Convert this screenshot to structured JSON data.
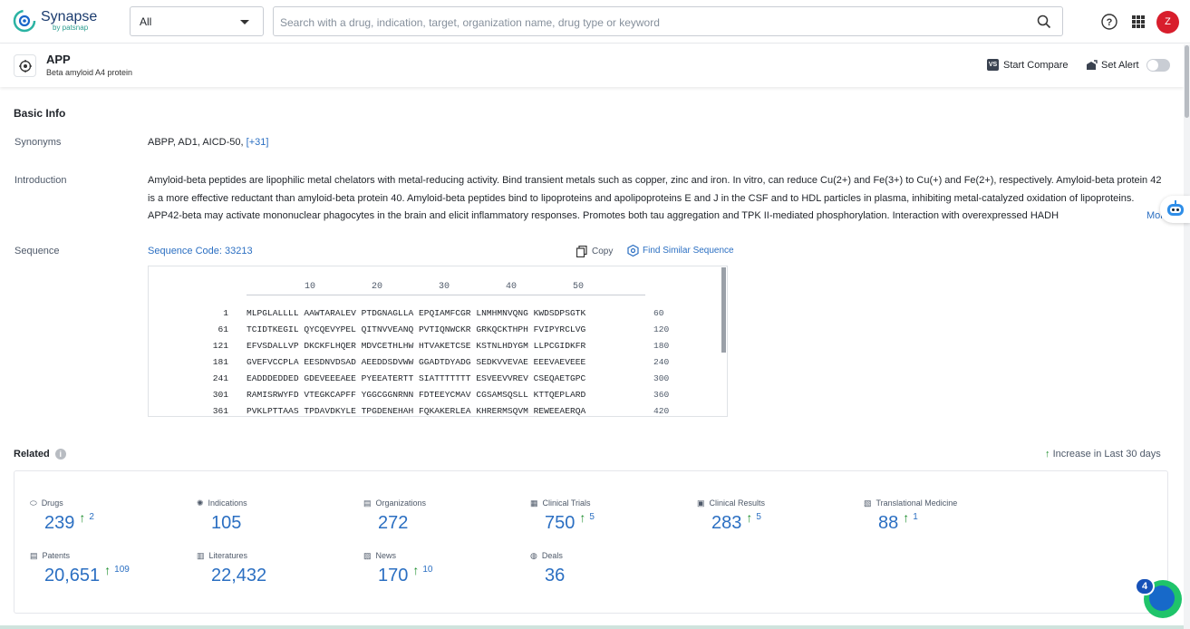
{
  "app": {
    "name": "Synapse",
    "by": "by patsnap"
  },
  "search": {
    "category": "All",
    "placeholder": "Search with a drug, indication, target, organization name, drug type or keyword"
  },
  "user": {
    "avatar_letter": "Z"
  },
  "target": {
    "title": "APP",
    "subtitle": "Beta amyloid A4 protein",
    "compare_label": "Start Compare",
    "compare_badge": "VS",
    "alert_label": "Set Alert"
  },
  "basic_info": {
    "title": "Basic Info",
    "synonyms_label": "Synonyms",
    "synonyms": "ABPP,  AD1,  AICD-50,",
    "synonyms_more": "[+31]",
    "introduction_label": "Introduction",
    "introduction": "Amyloid-beta peptides are lipophilic metal chelators with metal-reducing activity. Bind transient metals such as copper, zinc and iron. In vitro, can reduce Cu(2+) and Fe(3+) to Cu(+) and Fe(2+), respectively. Amyloid-beta protein 42 is a more effective reductant than amyloid-beta protein 40. Amyloid-beta peptides bind to lipoproteins and apolipoproteins E and J in the CSF and to HDL particles in plasma, inhibiting metal-catalyzed oxidation of lipoproteins. APP42-beta may activate mononuclear phagocytes in the brain and elicit inflammatory responses. Promotes both tau aggregation and TPK II-mediated phosphorylation. Interaction with overexpressed HADH",
    "introduction_more": "More",
    "sequence_label": "Sequence",
    "sequence_code": "Sequence Code: 33213",
    "copy_label": "Copy",
    "find_similar_label": "Find Similar Sequence",
    "ruler": [
      "10",
      "20",
      "30",
      "40",
      "50"
    ],
    "sequence_rows": [
      {
        "start": "1",
        "seq": "MLPGLALLLL AAWTARALEV PTDGNAGLLA EPQIAMFCGR LNMHMNVQNG KWDSDPSGTK",
        "end": "60"
      },
      {
        "start": "61",
        "seq": "TCIDTKEGIL QYCQEVYPEL QITNVVEANQ PVTIQNWCKR GRKQCKTHPH FVIPYRCLVG",
        "end": "120"
      },
      {
        "start": "121",
        "seq": "EFVSDALLVP DKCKFLHQER MDVCETHLHW HTVAKETCSE KSTNLHDYGM LLPCGIDKFR",
        "end": "180"
      },
      {
        "start": "181",
        "seq": "GVEFVCCPLA EESDNVDSAD AEEDDSDVWW GGADTDYADG SEDKVVEVAE EEEVAEVEEE",
        "end": "240"
      },
      {
        "start": "241",
        "seq": "EADDDEDDED GDEVEEEAEE PYEEATERTT SIATTTTTTT ESVEEVVREV CSEQAETGPC",
        "end": "300"
      },
      {
        "start": "301",
        "seq": "RAMISRWYFD VTEGKCAPFF YGGCGGNRNN FDTEEYCMAV CGSAMSQSLL KTTQEPLARD",
        "end": "360"
      },
      {
        "start": "361",
        "seq": "PVKLPTTAAS TPDAVDKYLE TPGDENEHAH FQKAKERLEA KHRERMSQVM REWEEAERQA",
        "end": "420"
      }
    ]
  },
  "related": {
    "title": "Related",
    "increase_label": "Increase in Last 30 days",
    "stats": [
      {
        "label": "Drugs",
        "value": "239",
        "inc": "2",
        "icon": "pill-icon"
      },
      {
        "label": "Indications",
        "value": "105",
        "inc": "",
        "icon": "virus-icon"
      },
      {
        "label": "Organizations",
        "value": "272",
        "inc": "",
        "icon": "building-icon"
      },
      {
        "label": "Clinical Trials",
        "value": "750",
        "inc": "5",
        "icon": "clipboard-icon"
      },
      {
        "label": "Clinical Results",
        "value": "283",
        "inc": "5",
        "icon": "results-icon"
      },
      {
        "label": "Translational Medicine",
        "value": "88",
        "inc": "1",
        "icon": "flask-doc-icon"
      },
      {
        "label": "Patents",
        "value": "20,651",
        "inc": "109",
        "icon": "patent-icon"
      },
      {
        "label": "Literatures",
        "value": "22,432",
        "inc": "",
        "icon": "book-icon"
      },
      {
        "label": "News",
        "value": "170",
        "inc": "10",
        "icon": "newspaper-icon"
      },
      {
        "label": "Deals",
        "value": "36",
        "inc": "",
        "icon": "handshake-icon"
      }
    ]
  },
  "chat_badge": "4",
  "colors": {
    "accent": "#2b6fc2",
    "increase": "#1f8f2f",
    "avatar": "#d81e2c"
  }
}
